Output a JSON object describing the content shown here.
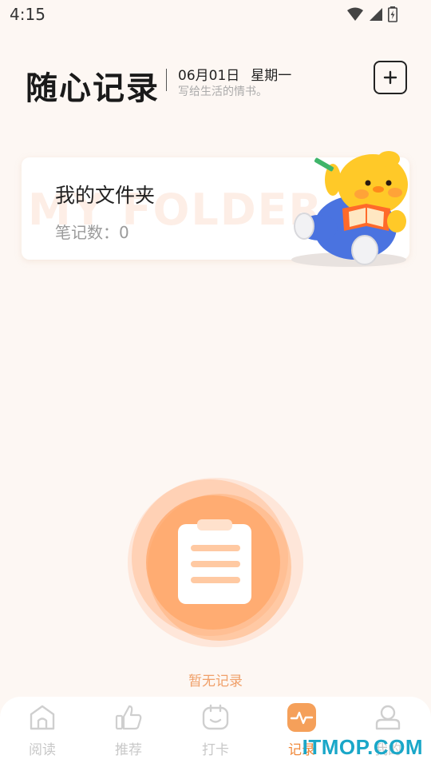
{
  "status_bar": {
    "time": "4:15"
  },
  "header": {
    "app_title": "随心记录",
    "date": "06月01日",
    "weekday": "星期一",
    "subtitle": "写给生活的情书。",
    "add_button_icon": "plus-icon"
  },
  "folder_card": {
    "watermark": "MY FOLDER",
    "title": "我的文件夹",
    "count_label": "笔记数：0"
  },
  "empty_state": {
    "icon": "clipboard-icon",
    "text": "暂无记录"
  },
  "bottom_nav": {
    "items": [
      {
        "label": "阅读",
        "icon": "home-icon",
        "active": false
      },
      {
        "label": "推荐",
        "icon": "thumbs-up-icon",
        "active": false
      },
      {
        "label": "打卡",
        "icon": "checkin-icon",
        "active": false
      },
      {
        "label": "记录",
        "icon": "pulse-icon",
        "active": true
      },
      {
        "label": "我的",
        "icon": "user-icon",
        "active": false
      }
    ]
  },
  "brand_watermark": "ITMOP.COM",
  "colors": {
    "accent": "#f08a3c",
    "background": "#fdf7f3",
    "inactive": "#c8c8c8"
  }
}
